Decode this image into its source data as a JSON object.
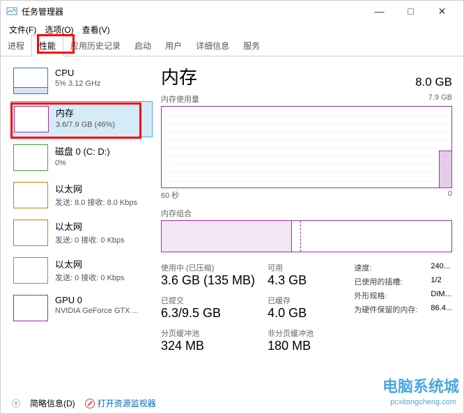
{
  "window": {
    "title": "任务管理器",
    "min": "—",
    "max": "□",
    "close": "✕"
  },
  "menu": {
    "file": "文件(F)",
    "options": "选项(O)",
    "view": "查看(V)"
  },
  "tabs": {
    "processes": "进程",
    "performance": "性能",
    "history": "应用历史记录",
    "startup": "启动",
    "users": "用户",
    "details": "详细信息",
    "services": "服务"
  },
  "sidebar": {
    "cpu": {
      "title": "CPU",
      "sub": "5%  3.12 GHz"
    },
    "mem": {
      "title": "内存",
      "sub": "3.6/7.9 GB (46%)"
    },
    "disk": {
      "title": "磁盘 0 (C: D:)",
      "sub": "0%"
    },
    "net1": {
      "title": "以太网",
      "sub": "发送: 8.0  接收: 8.0 Kbps"
    },
    "net2": {
      "title": "以太网",
      "sub": "发送: 0  接收: 0 Kbps"
    },
    "net3": {
      "title": "以太网",
      "sub": "发送: 0  接收: 0 Kbps"
    },
    "gpu": {
      "title": "GPU 0",
      "sub": "NVIDIA GeForce GTX ..."
    }
  },
  "main": {
    "heading": "内存",
    "total": "8.0 GB",
    "usage_label": "内存使用量",
    "usage_max": "7.9 GB",
    "axis_left": "60 秒",
    "axis_right": "0",
    "comp_label": "内存组合",
    "stats": {
      "inuse_label": "使用中 (已压缩)",
      "inuse_value": "3.6 GB (135 MB)",
      "avail_label": "可用",
      "avail_value": "4.3 GB",
      "commit_label": "已提交",
      "commit_value": "6.3/9.5 GB",
      "cached_label": "已缓存",
      "cached_value": "4.0 GB",
      "paged_label": "分页缓冲池",
      "paged_value": "324 MB",
      "nonpaged_label": "非分页缓冲池",
      "nonpaged_value": "180 MB"
    },
    "details": {
      "speed_k": "速度:",
      "speed_v": "240...",
      "slots_k": "已使用的插槽:",
      "slots_v": "1/2",
      "form_k": "外形规格:",
      "form_v": "DIM...",
      "hw_k": "为硬件保留的内存:",
      "hw_v": "86.4..."
    }
  },
  "footer": {
    "brief": "简略信息(D)",
    "resmon": "打开资源监视器"
  },
  "watermark": {
    "main": "电脑系统城",
    "sub": "pcxitongcheng.com"
  }
}
